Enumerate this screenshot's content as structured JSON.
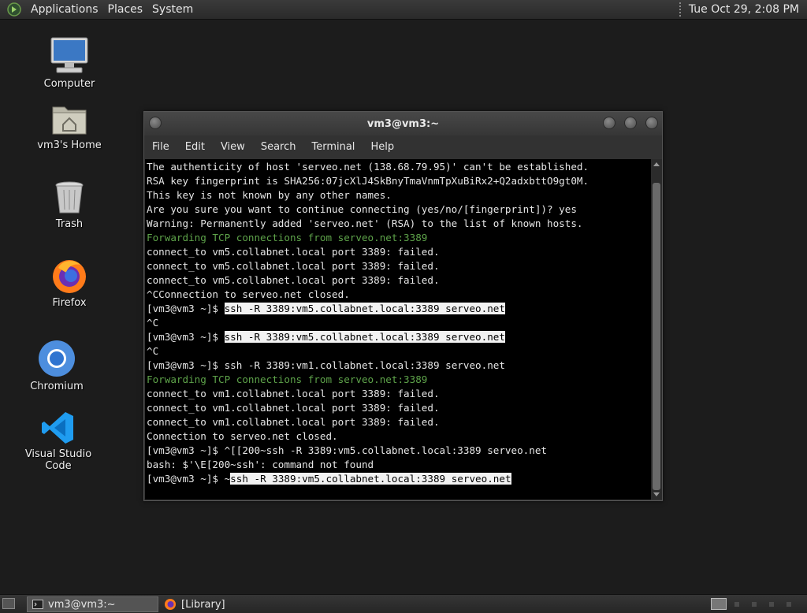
{
  "top_panel": {
    "menus": [
      "Applications",
      "Places",
      "System"
    ],
    "clock": "Tue Oct 29,  2:08 PM"
  },
  "desktop_icons": [
    {
      "name": "computer",
      "label": "Computer",
      "icon": "computer-icon"
    },
    {
      "name": "home",
      "label": "vm3's Home",
      "icon": "folder-home-icon"
    },
    {
      "name": "trash",
      "label": "Trash",
      "icon": "trash-icon"
    },
    {
      "name": "firefox",
      "label": "Firefox",
      "icon": "firefox-icon"
    },
    {
      "name": "chromium",
      "label": "Chromium",
      "icon": "chromium-icon"
    },
    {
      "name": "vscode",
      "label": "Visual Studio Code",
      "icon": "vscode-icon"
    }
  ],
  "terminal": {
    "title": "vm3@vm3:~",
    "menu": [
      "File",
      "Edit",
      "View",
      "Search",
      "Terminal",
      "Help"
    ],
    "lines": [
      {
        "text": "The authenticity of host 'serveo.net (138.68.79.95)' can't be established."
      },
      {
        "text": "RSA key fingerprint is SHA256:07jcXlJ4SkBnyTmaVnmTpXuBiRx2+Q2adxbttO9gt0M."
      },
      {
        "text": "This key is not known by any other names."
      },
      {
        "text": "Are you sure you want to continue connecting (yes/no/[fingerprint])? yes"
      },
      {
        "text": "Warning: Permanently added 'serveo.net' (RSA) to the list of known hosts."
      },
      {
        "text": "Forwarding TCP connections from serveo.net:3389",
        "style": "green"
      },
      {
        "text": "connect_to vm5.collabnet.local port 3389: failed."
      },
      {
        "text": "connect_to vm5.collabnet.local port 3389: failed."
      },
      {
        "text": "connect_to vm5.collabnet.local port 3389: failed."
      },
      {
        "text": "^CConnection to serveo.net closed."
      },
      {
        "prompt": "[vm3@vm3 ~]$ ",
        "cmd": "ssh -R 3389:vm5.collabnet.local:3389 serveo.net",
        "highlight": true
      },
      {
        "text": "^C"
      },
      {
        "prompt": "[vm3@vm3 ~]$ ",
        "cmd": "ssh -R 3389:vm5.collabnet.local:3389 serveo.net",
        "highlight": true
      },
      {
        "text": "^C"
      },
      {
        "prompt": "[vm3@vm3 ~]$ ",
        "cmd": "ssh -R 3389:vm1.collabnet.local:3389 serveo.net",
        "highlight": false
      },
      {
        "text": "Forwarding TCP connections from serveo.net:3389",
        "style": "green"
      },
      {
        "text": "connect_to vm1.collabnet.local port 3389: failed."
      },
      {
        "text": "connect_to vm1.collabnet.local port 3389: failed."
      },
      {
        "text": "connect_to vm1.collabnet.local port 3389: failed."
      },
      {
        "text": "Connection to serveo.net closed."
      },
      {
        "prompt": "[vm3@vm3 ~]$ ",
        "cmd": "^[[200~ssh -R 3389:vm5.collabnet.local:3389 serveo.net",
        "highlight": false
      },
      {
        "text": "bash: $'\\E[200~ssh': command not found"
      },
      {
        "prompt": "[vm3@vm3 ~]$ ",
        "pre": "~",
        "cmd": "ssh -R 3389:vm5.collabnet.local:3389 serveo.net",
        "highlight": true
      }
    ]
  },
  "taskbar": {
    "tasks": [
      {
        "label": "vm3@vm3:~",
        "icon": "terminal-icon",
        "active": true
      },
      {
        "label": "[Library]",
        "icon": "firefox-icon",
        "active": false
      }
    ]
  },
  "colors": {
    "terminal_green": "#5ea34a",
    "selection_bg": "#f2f2f2"
  }
}
